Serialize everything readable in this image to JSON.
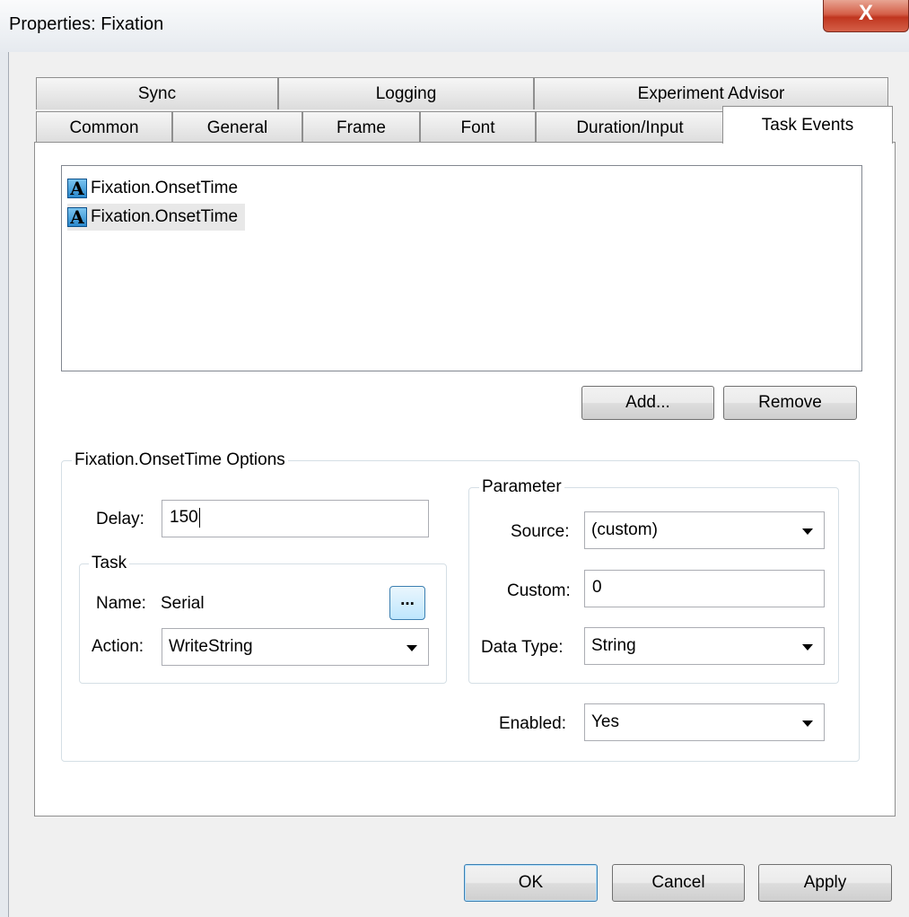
{
  "window": {
    "title": "Properties: Fixation",
    "close_glyph": "X"
  },
  "tabs": {
    "row1": [
      "Sync",
      "Logging",
      "Experiment Advisor"
    ],
    "row2": [
      "Common",
      "General",
      "Frame",
      "Font",
      "Duration/Input",
      "Task Events"
    ],
    "active": "Task Events"
  },
  "events": {
    "items": [
      {
        "icon": "text-a-icon",
        "glyph": "A",
        "label": "Fixation.OnsetTime",
        "selected": false
      },
      {
        "icon": "text-a-icon",
        "glyph": "A",
        "label": "Fixation.OnsetTime",
        "selected": true
      }
    ],
    "add_label": "Add...",
    "remove_label": "Remove"
  },
  "options": {
    "title": "Fixation.OnsetTime Options",
    "delay_label": "Delay:",
    "delay_value": "150",
    "task": {
      "title": "Task",
      "name_label": "Name:",
      "name_value": "Serial",
      "browse_label": "...",
      "action_label": "Action:",
      "action_value": "WriteString"
    },
    "parameter": {
      "title": "Parameter",
      "source_label": "Source:",
      "source_value": "(custom)",
      "custom_label": "Custom:",
      "custom_value": "0",
      "datatype_label": "Data Type:",
      "datatype_value": "String"
    },
    "enabled_label": "Enabled:",
    "enabled_value": "Yes"
  },
  "footer": {
    "ok_label": "OK",
    "cancel_label": "Cancel",
    "apply_label": "Apply"
  },
  "colors": {
    "close_red": "#c0361f",
    "default_button_border": "#3c7fb1",
    "panel": "#ffffff",
    "dialog": "#f0f0f0"
  }
}
